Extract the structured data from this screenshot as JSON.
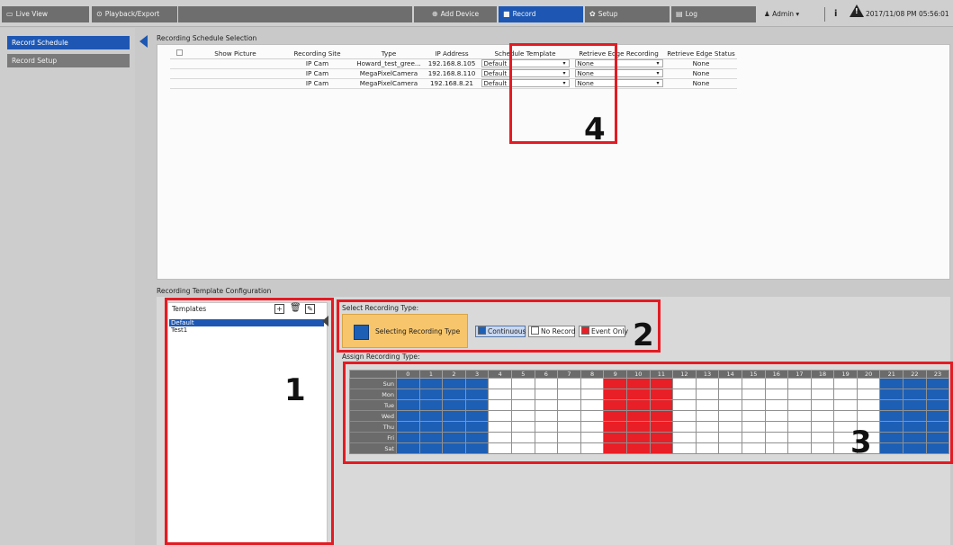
{
  "topnav": {
    "live_view": "Live View",
    "playback_export": "Playback/Export",
    "add_device": "Add Device",
    "record": "Record",
    "setup": "Setup",
    "log": "Log",
    "admin": "Admin",
    "datetime": "2017/11/08 PM 05:56:01"
  },
  "sidebar": {
    "items": [
      {
        "label": "Record Schedule"
      },
      {
        "label": "Record Setup"
      }
    ]
  },
  "schedule": {
    "section_title": "Recording Schedule Selection",
    "columns": [
      "Show Picture",
      "Recording Site",
      "Type",
      "IP Address",
      "Schedule Template",
      "Retrieve Edge Recording",
      "Retrieve Edge Status"
    ],
    "rows": [
      {
        "site": "IP Cam",
        "type": "Howard_test_gree...",
        "ip": "192.168.8.105",
        "template": "Default",
        "edge": "None",
        "status": "None"
      },
      {
        "site": "IP Cam",
        "type": "MegaPixelCamera",
        "ip": "192.168.8.110",
        "template": "Default",
        "edge": "None",
        "status": "None"
      },
      {
        "site": "IP Cam",
        "type": "MegaPixelCamera",
        "ip": "192.168.8.21",
        "template": "Default",
        "edge": "None",
        "status": "None"
      }
    ]
  },
  "config": {
    "section_title": "Recording Template Configuration",
    "templates_label": "Templates",
    "templates": [
      "Default",
      "Test1"
    ],
    "select_type_label": "Select Recording Type:",
    "selecting_type_label": "Selecting Recording Type",
    "assign_label": "Assign Recording Type:",
    "legend": {
      "continuous": "Continuous",
      "no_record": "No Record",
      "event_only": "Event Only"
    },
    "colors": {
      "continuous": "#1d5fb4",
      "no_record": "#ffffff",
      "event_only": "#e81f26"
    },
    "hours": [
      "0",
      "1",
      "2",
      "3",
      "4",
      "5",
      "6",
      "7",
      "8",
      "9",
      "10",
      "11",
      "12",
      "13",
      "14",
      "15",
      "16",
      "17",
      "18",
      "19",
      "20",
      "21",
      "22",
      "23"
    ],
    "days": [
      "Sun",
      "Mon",
      "Tue",
      "Wed",
      "Thu",
      "Fri",
      "Sat"
    ],
    "hour_types": [
      "continuous",
      "continuous",
      "continuous",
      "continuous",
      "no_record",
      "no_record",
      "no_record",
      "no_record",
      "no_record",
      "event_only",
      "event_only",
      "event_only",
      "no_record",
      "no_record",
      "no_record",
      "no_record",
      "no_record",
      "no_record",
      "no_record",
      "no_record",
      "no_record",
      "continuous",
      "continuous",
      "continuous"
    ]
  },
  "annotations": {
    "n1": "1",
    "n2": "2",
    "n3": "3",
    "n4": "4"
  }
}
